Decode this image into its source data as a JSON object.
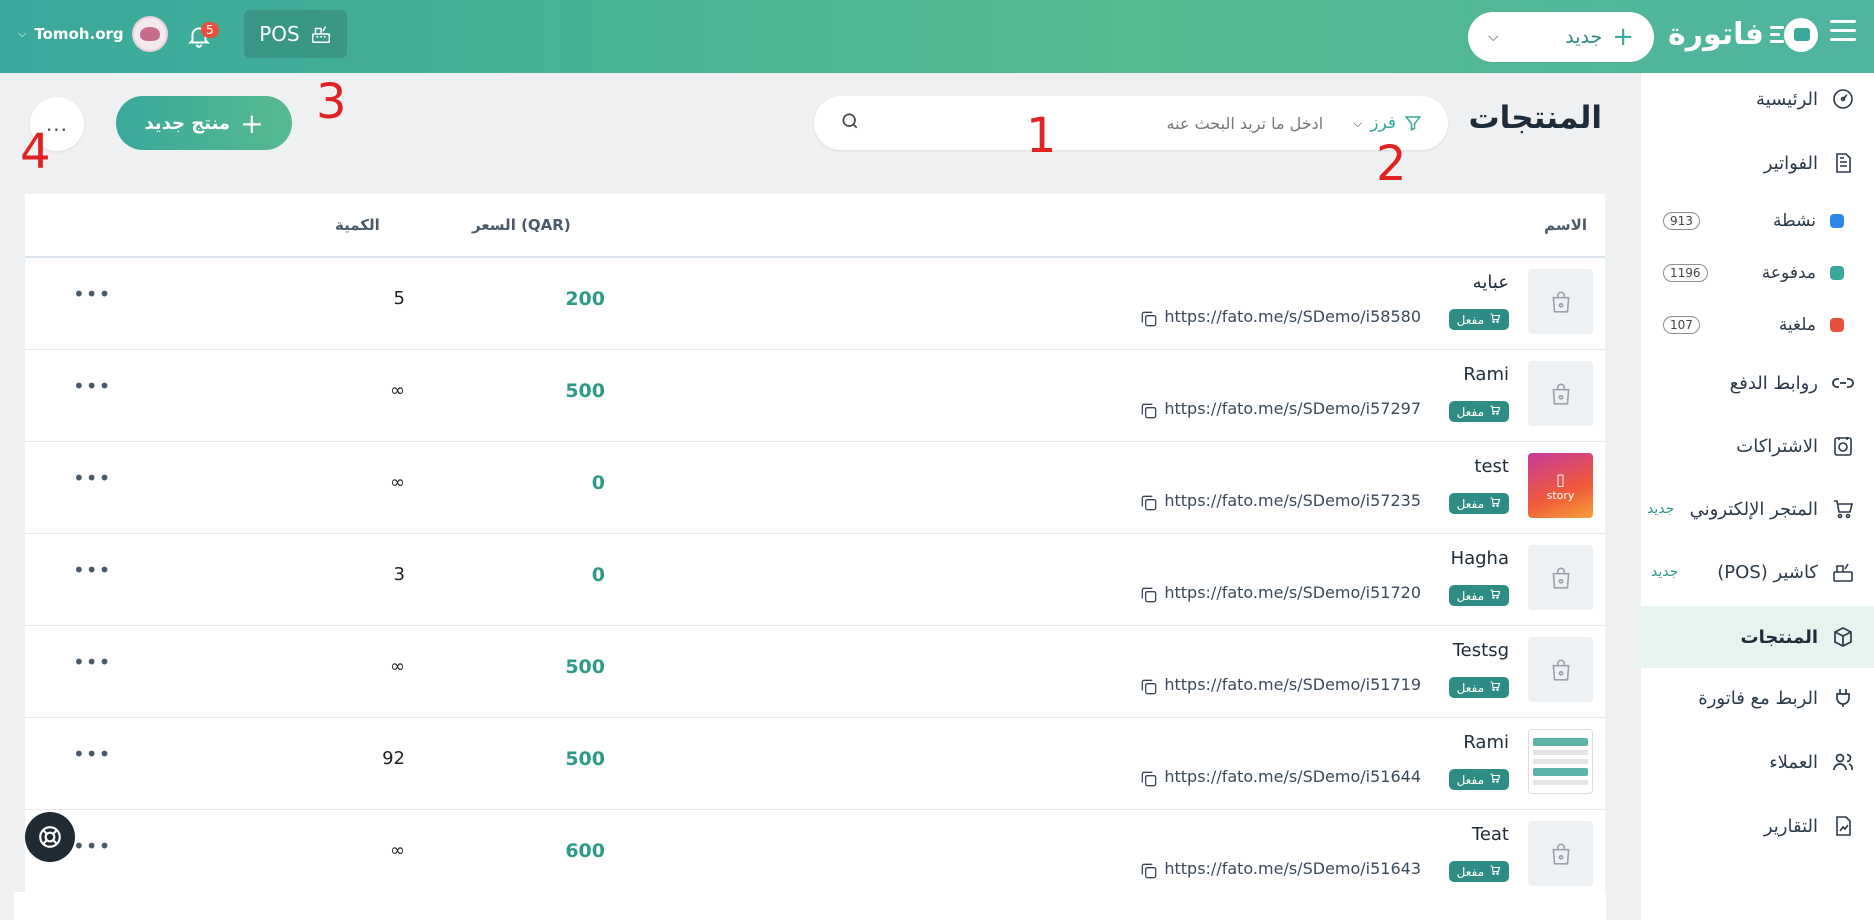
{
  "header": {
    "logo_text": "فاتورة",
    "new_button_label": "جديد",
    "pos_label": "POS",
    "notifications_count": "5",
    "account_name": "Tomoh.org",
    "accent_color": "#3aa99c"
  },
  "sidebar": {
    "items": [
      {
        "label": "الرئيسية",
        "icon": "dashboard-icon"
      },
      {
        "label": "الفواتير",
        "icon": "invoice-icon"
      },
      {
        "label": "روابط الدفع",
        "icon": "link-icon"
      },
      {
        "label": "الاشتراكات",
        "icon": "subscription-icon"
      },
      {
        "label": "المتجر الإلكتروني",
        "icon": "cart-icon",
        "tag": "جديد"
      },
      {
        "label": "كاشير (POS)",
        "icon": "register-icon",
        "tag": "جديد"
      },
      {
        "label": "المنتجات",
        "icon": "box-icon",
        "active": true
      },
      {
        "label": "الربط مع فاتورة",
        "icon": "plug-icon"
      },
      {
        "label": "العملاء",
        "icon": "users-icon"
      },
      {
        "label": "التقارير",
        "icon": "report-icon"
      }
    ],
    "invoice_sub": [
      {
        "label": "نشطة",
        "count": "913",
        "color": "#2a86e8"
      },
      {
        "label": "مدفوعة",
        "count": "1196",
        "color": "#3aa99c"
      },
      {
        "label": "ملغية",
        "count": "107",
        "color": "#e8503e"
      }
    ]
  },
  "main": {
    "title": "المنتجات",
    "search_placeholder": "ادخل ما تريد البحث عنه",
    "sort_label": "فرز",
    "add_product_label": "منتج جديد",
    "more_label": "...",
    "markers": [
      "1",
      "2",
      "3",
      "4"
    ]
  },
  "table": {
    "columns": {
      "name": "الاسم",
      "price": "السعر (QAR)",
      "qty": "الكمية"
    },
    "status_label": "مفعل",
    "row_more": "•••",
    "rows": [
      {
        "name": "عبايه",
        "link": "https://fato.me/s/SDemo/i58580",
        "price": "200",
        "qty": "5",
        "thumb": "placeholder"
      },
      {
        "name": "Rami",
        "link": "https://fato.me/s/SDemo/i57297",
        "price": "500",
        "qty": "∞",
        "thumb": "placeholder"
      },
      {
        "name": "test",
        "link": "https://fato.me/s/SDemo/i57235",
        "price": "0",
        "qty": "∞",
        "thumb": "story"
      },
      {
        "name": "Hagha",
        "link": "https://fato.me/s/SDemo/i51720",
        "price": "0",
        "qty": "3",
        "thumb": "placeholder"
      },
      {
        "name": "Testsg",
        "link": "https://fato.me/s/SDemo/i51719",
        "price": "500",
        "qty": "∞",
        "thumb": "placeholder"
      },
      {
        "name": "Rami",
        "link": "https://fato.me/s/SDemo/i51644",
        "price": "500",
        "qty": "92",
        "thumb": "screenshot"
      },
      {
        "name": "Teat",
        "link": "https://fato.me/s/SDemo/i51643",
        "price": "600",
        "qty": "∞",
        "thumb": "placeholder"
      }
    ]
  }
}
